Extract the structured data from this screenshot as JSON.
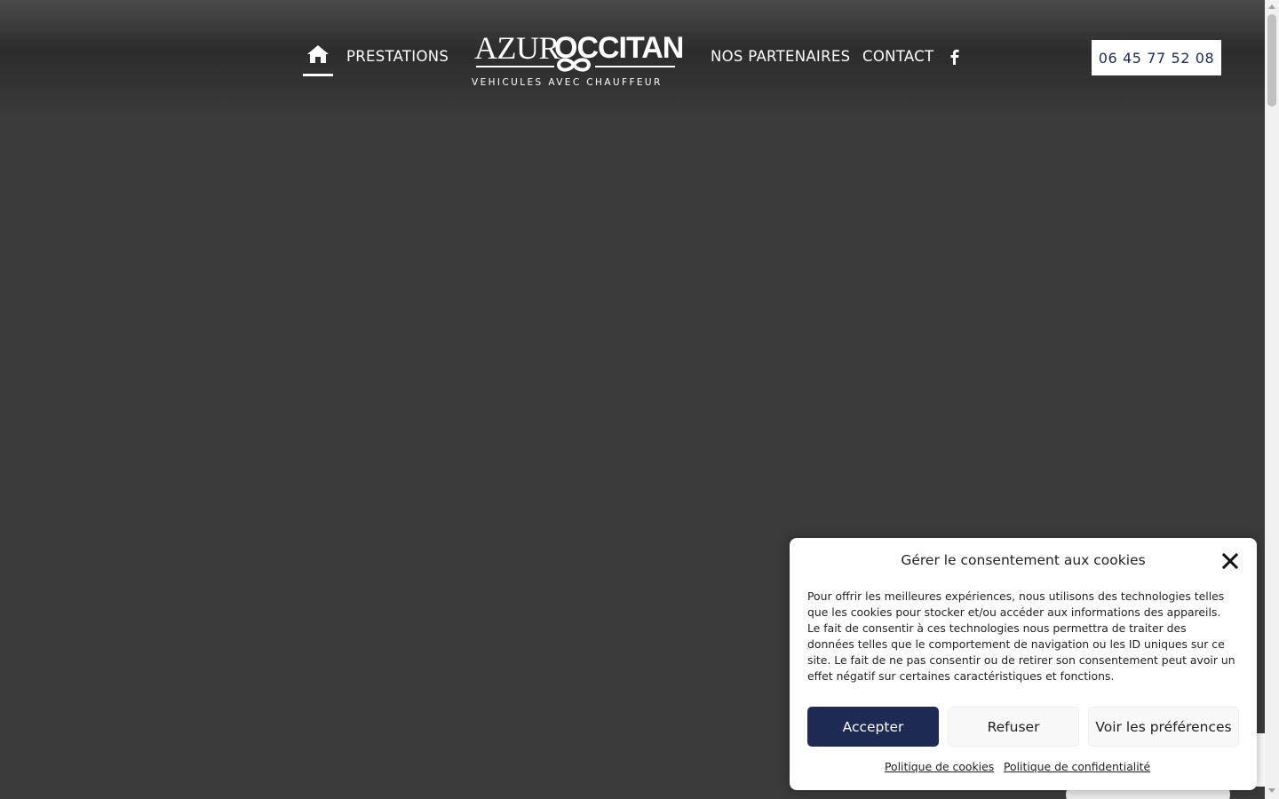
{
  "header": {
    "nav": {
      "home_icon": "home-icon",
      "prestations": "PRESTATIONS",
      "partenaires": "NOS PARTENAIRES",
      "contact": "CONTACT",
      "facebook_icon": "facebook-icon"
    },
    "logo": {
      "azur": "AZUR",
      "occitan": "OCCITAN",
      "tagline": "VEHICULES AVEC CHAUFFEUR"
    },
    "phone": "06 45 77 52 08"
  },
  "cookie_dialog": {
    "title": "Gérer le consentement aux cookies",
    "close_icon": "close-icon",
    "text": "Pour offrir les meilleures expériences, nous utilisons des technologies telles que les cookies pour stocker et/ou accéder aux informations des appareils. Le fait de consentir à ces technologies nous permettra de traiter des données telles que le comportement de navigation ou les ID uniques sur ce site. Le fait de ne pas consentir ou de retirer son consentement peut avoir un effet négatif sur certaines caractéristiques et fonctions.",
    "accept": "Accepter",
    "refuse": "Refuser",
    "preferences": "Voir les préférences",
    "cookie_policy": "Politique de cookies",
    "privacy_policy": "Politique de confidentialité"
  },
  "colors": {
    "background": "#3b3b3b",
    "accent_navy": "#1e2a54",
    "phone_text": "#1d2a57"
  }
}
